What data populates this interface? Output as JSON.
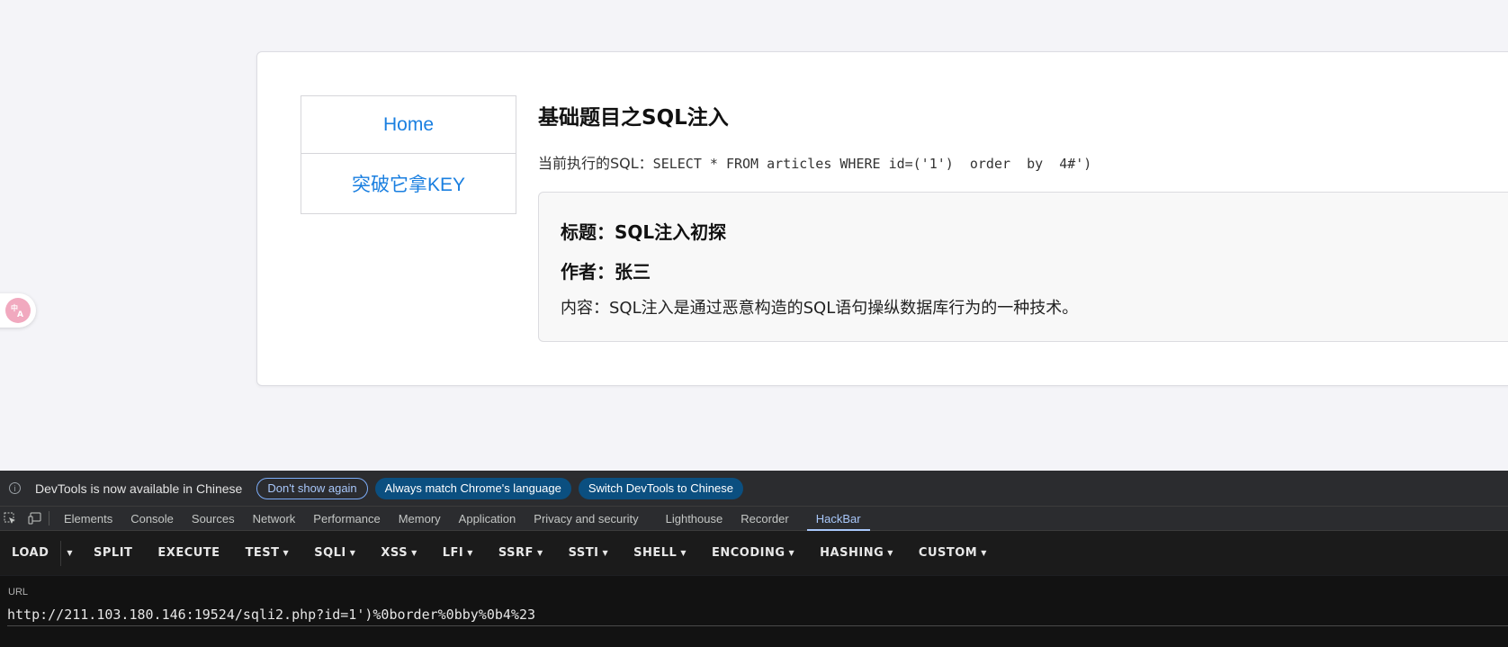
{
  "page": {
    "nav": [
      "Home",
      "突破它拿KEY"
    ],
    "title": "基础题目之SQL注入",
    "sql_prefix": "当前执行的SQL：",
    "sql_query": "SELECT * FROM articles WHERE id=('1')  order  by  4#')",
    "article": {
      "title": "标题：SQL注入初探",
      "author": "作者：张三",
      "content": "内容：SQL注入是通过恶意构造的SQL语句操纵数据库行为的一种技术。"
    },
    "translate_icon": "translate-icon"
  },
  "devtools": {
    "info_message": "DevTools is now available in Chinese",
    "info_buttons": [
      "Don't show again",
      "Always match Chrome's language",
      "Switch DevTools to Chinese"
    ],
    "tabs": [
      "Elements",
      "Console",
      "Sources",
      "Network",
      "Performance",
      "Memory",
      "Application",
      "Privacy and security",
      "Lighthouse",
      "Recorder",
      "HackBar"
    ],
    "active_tab": "HackBar"
  },
  "hackbar": {
    "load": "LOAD",
    "split": "SPLIT",
    "execute": "EXECUTE",
    "menus": [
      "TEST",
      "SQLI",
      "XSS",
      "LFI",
      "SSRF",
      "SSTI",
      "SHELL",
      "ENCODING",
      "HASHING",
      "CUSTOM"
    ],
    "url_label": "URL",
    "url_value": "http://211.103.180.146:19524/sqli2.php?id=1')%0border%0bby%0b4%23"
  }
}
